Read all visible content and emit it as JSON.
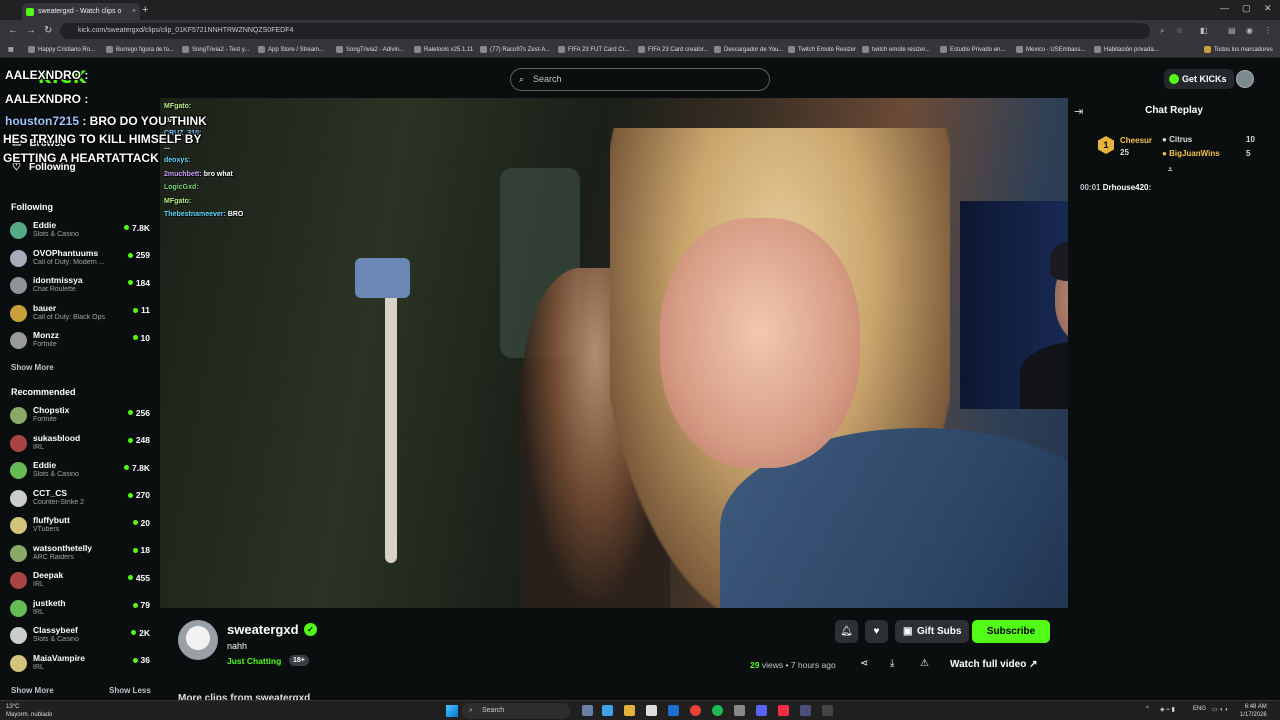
{
  "browser": {
    "tab_title": "sweatergxd - Watch clips o",
    "tab_close": "×",
    "new_tab": "+",
    "url": "kick.com/sweatergxd/clips/clip_01KF5721NNHTRWZNNQZS0FEDF4",
    "bookmarks": [
      "Happy Cristiano Ro...",
      "Burrego figura de to...",
      "SongTrivia2 - Test y...",
      "App Store / Stream...",
      "SongTrivia2 - Adivin...",
      "Raletools v25.1.11",
      "(77) Raco97s Zest-A...",
      "FIFA 23 FUT Card Cr...",
      "FIFA 23 Card creator...",
      "Descargador de You...",
      "Twitch Emote Resizer",
      "twitch emote resizer...",
      "Estudio Privado en...",
      "Mexico - USEmbass...",
      "Habitación privada..."
    ],
    "all_bookmarks": "Todos los marcadores"
  },
  "sidebar": {
    "logo": "KICK",
    "nav": {
      "browse": "Browse",
      "following": "Following"
    },
    "following_title": "Following",
    "following": [
      {
        "name": "Eddie",
        "category": "Slots & Casino",
        "viewers": "7.8K"
      },
      {
        "name": "OVOPhantuums",
        "category": "Call of Duty: Modern ...",
        "viewers": "259"
      },
      {
        "name": "idontmissya",
        "category": "Chat Roulette",
        "viewers": "184"
      },
      {
        "name": "bauer",
        "category": "Call of Duty: Black Ops",
        "viewers": "11"
      },
      {
        "name": "Monzz",
        "category": "Fortnite",
        "viewers": "10"
      }
    ],
    "show_more_1": "Show More",
    "recommended_title": "Recommended",
    "recommended": [
      {
        "name": "Chopstix",
        "category": "Fortnite",
        "viewers": "256"
      },
      {
        "name": "sukasblood",
        "category": "IRL",
        "viewers": "248"
      },
      {
        "name": "Eddie",
        "category": "Slots & Casino",
        "viewers": "7.8K"
      },
      {
        "name": "CCT_CS",
        "category": "Counter-Strike 2",
        "viewers": "270"
      },
      {
        "name": "fluffybutt",
        "category": "VTubers",
        "viewers": "20"
      },
      {
        "name": "watsonthetelly",
        "category": "ARC Raiders",
        "viewers": "18"
      },
      {
        "name": "Deepak",
        "category": "IRL",
        "viewers": "455"
      },
      {
        "name": "justketh",
        "category": "IRL",
        "viewers": "79"
      },
      {
        "name": "Classybeef",
        "category": "Slots & Casino",
        "viewers": "2K"
      },
      {
        "name": "MaiaVampire",
        "category": "IRL",
        "viewers": "36"
      }
    ],
    "show_more_2": "Show More",
    "show_less": "Show Less"
  },
  "overlay": {
    "line1": "AALEXNDRO :",
    "line2": "AALEXNDRO :",
    "line3_user": "houston7215",
    "line3_msg": " : BRO DO YOU THINK",
    "line4": "HES TRYING TO KILL HIMSELF BY",
    "line5": "GETTING A HEARTATTACK"
  },
  "header": {
    "search_placeholder": "Search",
    "get_kicks": "Get KICKs"
  },
  "video_chat": [
    {
      "user": "MFgato:",
      "msg": ""
    },
    {
      "user": "",
      "msg": "20:"
    },
    {
      "user": "CRUZ_310:",
      "msg": ""
    },
    {
      "user": "",
      "msg": "..."
    },
    {
      "user": "deoxys:",
      "msg": ""
    },
    {
      "user": "2muchbett:",
      "msg": "bro what"
    },
    {
      "user": "LogicGxd:",
      "msg": ""
    },
    {
      "user": "",
      "msg": ""
    },
    {
      "user": "MFgato:",
      "msg": ""
    },
    {
      "user": "Thebestnameever:",
      "msg": "BRO"
    }
  ],
  "chat_panel": {
    "title": "Chat Replay",
    "rank": "1",
    "top1_name": "Cheesur",
    "top1_count": "25",
    "top2_name": "Citrus",
    "top2_count": "10",
    "top3_name": "BigJuanWins",
    "top3_count": "5",
    "replay_time": "00:01",
    "replay_user": "Drhouse420:"
  },
  "clip": {
    "channel": "sweatergxd",
    "title": "nahh",
    "category": "Just Chatting",
    "age_badge": "18+",
    "gift_subs": "Gift Subs",
    "subscribe": "Subscribe",
    "views_count": "29",
    "views_suffix": " views • 7 hours ago",
    "watch_full": "Watch full video",
    "more_clips": "More clips from sweatergxd"
  },
  "taskbar": {
    "temp": "13°C",
    "weather": "Mayorm. nublado",
    "search": "Search",
    "lang": "ENG",
    "time": "6:48 AM",
    "date": "1/17/2026"
  },
  "colors": {
    "kick_green": "#53fc18",
    "background": "#0b0e0f"
  }
}
